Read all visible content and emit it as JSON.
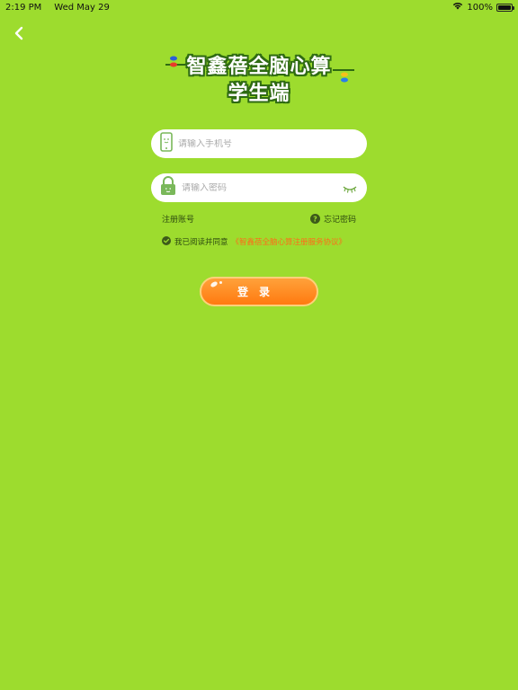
{
  "status_bar": {
    "time": "2:19 PM",
    "date": "Wed May 29",
    "battery": "100%",
    "battery_level": 1.0,
    "wifi_icon": "wifi-icon",
    "battery_icon": "battery-icon"
  },
  "nav": {
    "back_icon": "chevron-left-icon"
  },
  "header": {
    "title_line1": "智鑫蓓全脑心算",
    "title_line2": "学生端"
  },
  "form": {
    "phone_placeholder": "请输入手机号",
    "phone_value": "",
    "password_placeholder": "请输入密码",
    "password_value": "",
    "register_label": "注册账号",
    "forgot_label": "忘记密码",
    "agree_text": "我已阅读并同意",
    "agree_link": "《智鑫蓓全脑心算注册服务协议》",
    "agree_checked": true,
    "login_label": "登录"
  },
  "colors": {
    "background": "#9ddc2e",
    "accent": "#ff7a10",
    "icon_green": "#7ab85a",
    "link_orange": "#ff6b1a"
  }
}
